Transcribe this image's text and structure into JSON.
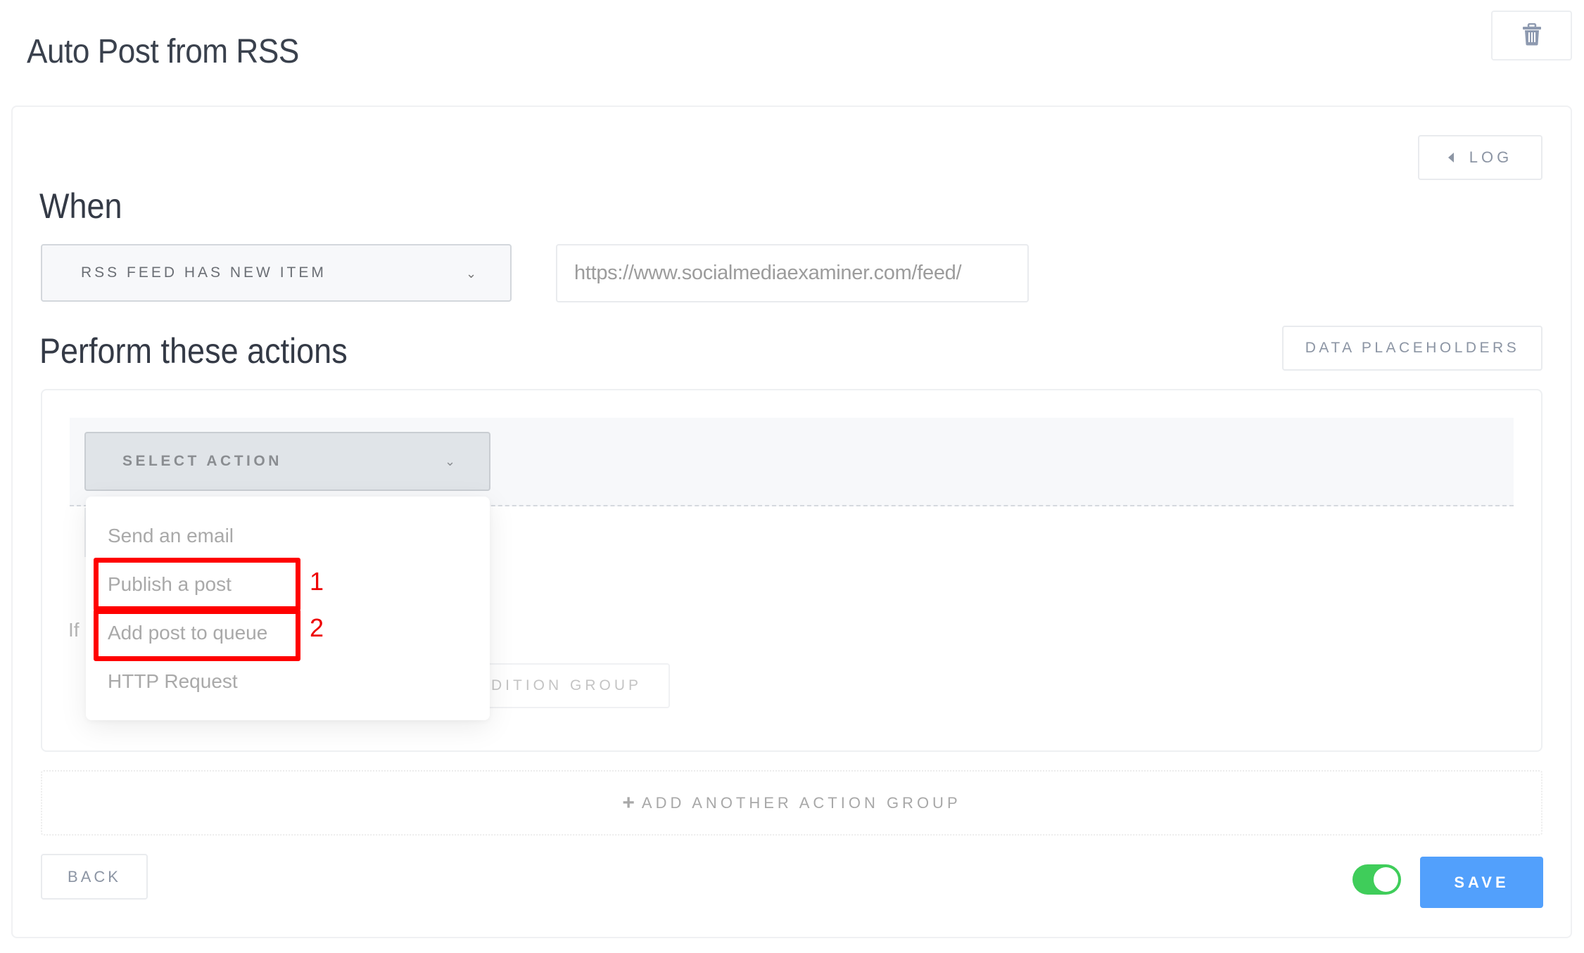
{
  "header": {
    "title": "Auto Post from RSS",
    "delete_icon": "trash-icon"
  },
  "card": {
    "log_button": {
      "label": "LOG",
      "icon": "caret-left-icon"
    },
    "when": {
      "title": "When",
      "trigger_select": {
        "value": "RSS FEED HAS NEW ITEM",
        "icon": "chevron-down-icon"
      },
      "feed_url_input": {
        "value": "https://www.socialmediaexaminer.com/feed/"
      }
    },
    "actions": {
      "title": "Perform these actions",
      "data_placeholders_label": "DATA PLACEHOLDERS",
      "action_select": {
        "value": "SELECT ACTION",
        "icon": "chevron-down-icon"
      },
      "condition_prefix": "If",
      "condition_group_label": "ADD CONDITION GROUP",
      "dropdown_options": [
        {
          "label": "Send an email"
        },
        {
          "label": "Publish a post"
        },
        {
          "label": "Add post to queue"
        },
        {
          "label": "HTTP Request"
        }
      ],
      "annotations": [
        {
          "number": "1",
          "target": "Publish a post",
          "color": "#ff0000"
        },
        {
          "number": "2",
          "target": "Add post to queue",
          "color": "#ff0000"
        }
      ]
    },
    "add_action_group": {
      "label": "ADD ANOTHER ACTION GROUP",
      "icon": "plus-icon"
    },
    "footer": {
      "back_label": "BACK",
      "enabled_toggle": {
        "on": true,
        "color": "#3fcd5a"
      },
      "save_label": "SAVE",
      "save_color": "#52a0fc"
    }
  }
}
